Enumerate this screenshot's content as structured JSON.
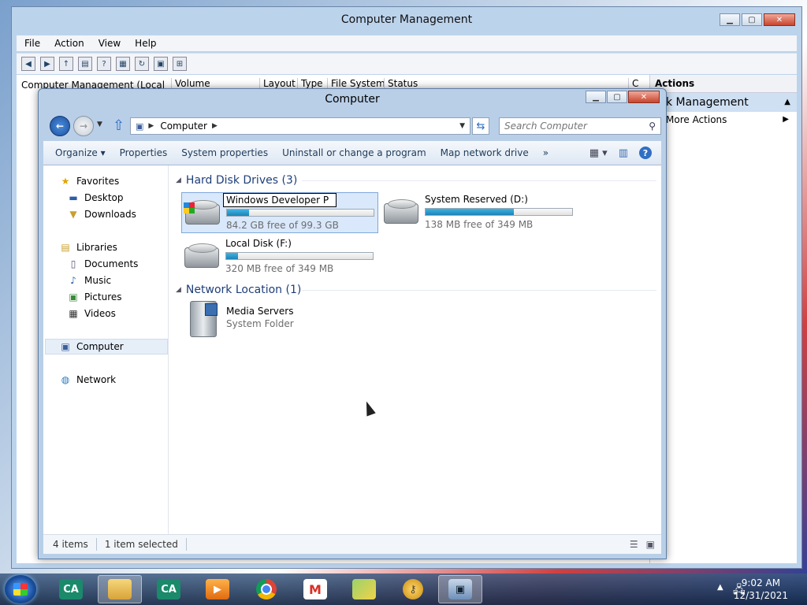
{
  "cm_window": {
    "title": "Computer Management",
    "menu": [
      "File",
      "Action",
      "View",
      "Help"
    ],
    "tree_root": "Computer Management (Local",
    "columns": [
      "Volume",
      "Layout",
      "Type",
      "File System",
      "Status",
      "C"
    ],
    "actions_header": "Actions",
    "actions_section": "k Management",
    "actions_item": "More Actions"
  },
  "explorer": {
    "title": "Computer",
    "breadcrumb": "Computer",
    "search_placeholder": "Search Computer",
    "commands": [
      "Organize ▾",
      "Properties",
      "System properties",
      "Uninstall or change a program",
      "Map network drive",
      "»"
    ],
    "nav": {
      "favorites": "Favorites",
      "desktop": "Desktop",
      "downloads": "Downloads",
      "libraries": "Libraries",
      "documents": "Documents",
      "music": "Music",
      "pictures": "Pictures",
      "videos": "Videos",
      "computer": "Computer",
      "network": "Network"
    },
    "groups": {
      "hdd": "Hard Disk Drives (3)",
      "network": "Network Location (1)"
    },
    "drives": [
      {
        "rename_value": "Windows Developer P",
        "free": "84.2 GB free of 99.3 GB",
        "used_fraction": 0.15
      },
      {
        "name": "System Reserved (D:)",
        "free": "138 MB free of 349 MB",
        "used_fraction": 0.6
      },
      {
        "name": "Local Disk (F:)",
        "free": "320 MB free of 349 MB",
        "used_fraction": 0.08
      }
    ],
    "network_item": {
      "name": "Media Servers",
      "type": "System Folder"
    },
    "status": {
      "items": "4 items",
      "selected": "1 item selected"
    }
  },
  "taskbar": {
    "time": "9:02 AM",
    "date": "12/31/2021",
    "apps": [
      {
        "icon": "credit-agricole-icon",
        "label": "CA"
      },
      {
        "icon": "file-explorer-icon",
        "label": ""
      },
      {
        "icon": "credit-agricole-icon",
        "label": "CA"
      },
      {
        "icon": "media-player-icon",
        "label": ""
      },
      {
        "icon": "chrome-icon",
        "label": ""
      },
      {
        "icon": "gmail-icon",
        "label": ""
      },
      {
        "icon": "folders-icon",
        "label": ""
      },
      {
        "icon": "security-icon",
        "label": ""
      },
      {
        "icon": "computer-management-icon",
        "label": ""
      }
    ]
  }
}
